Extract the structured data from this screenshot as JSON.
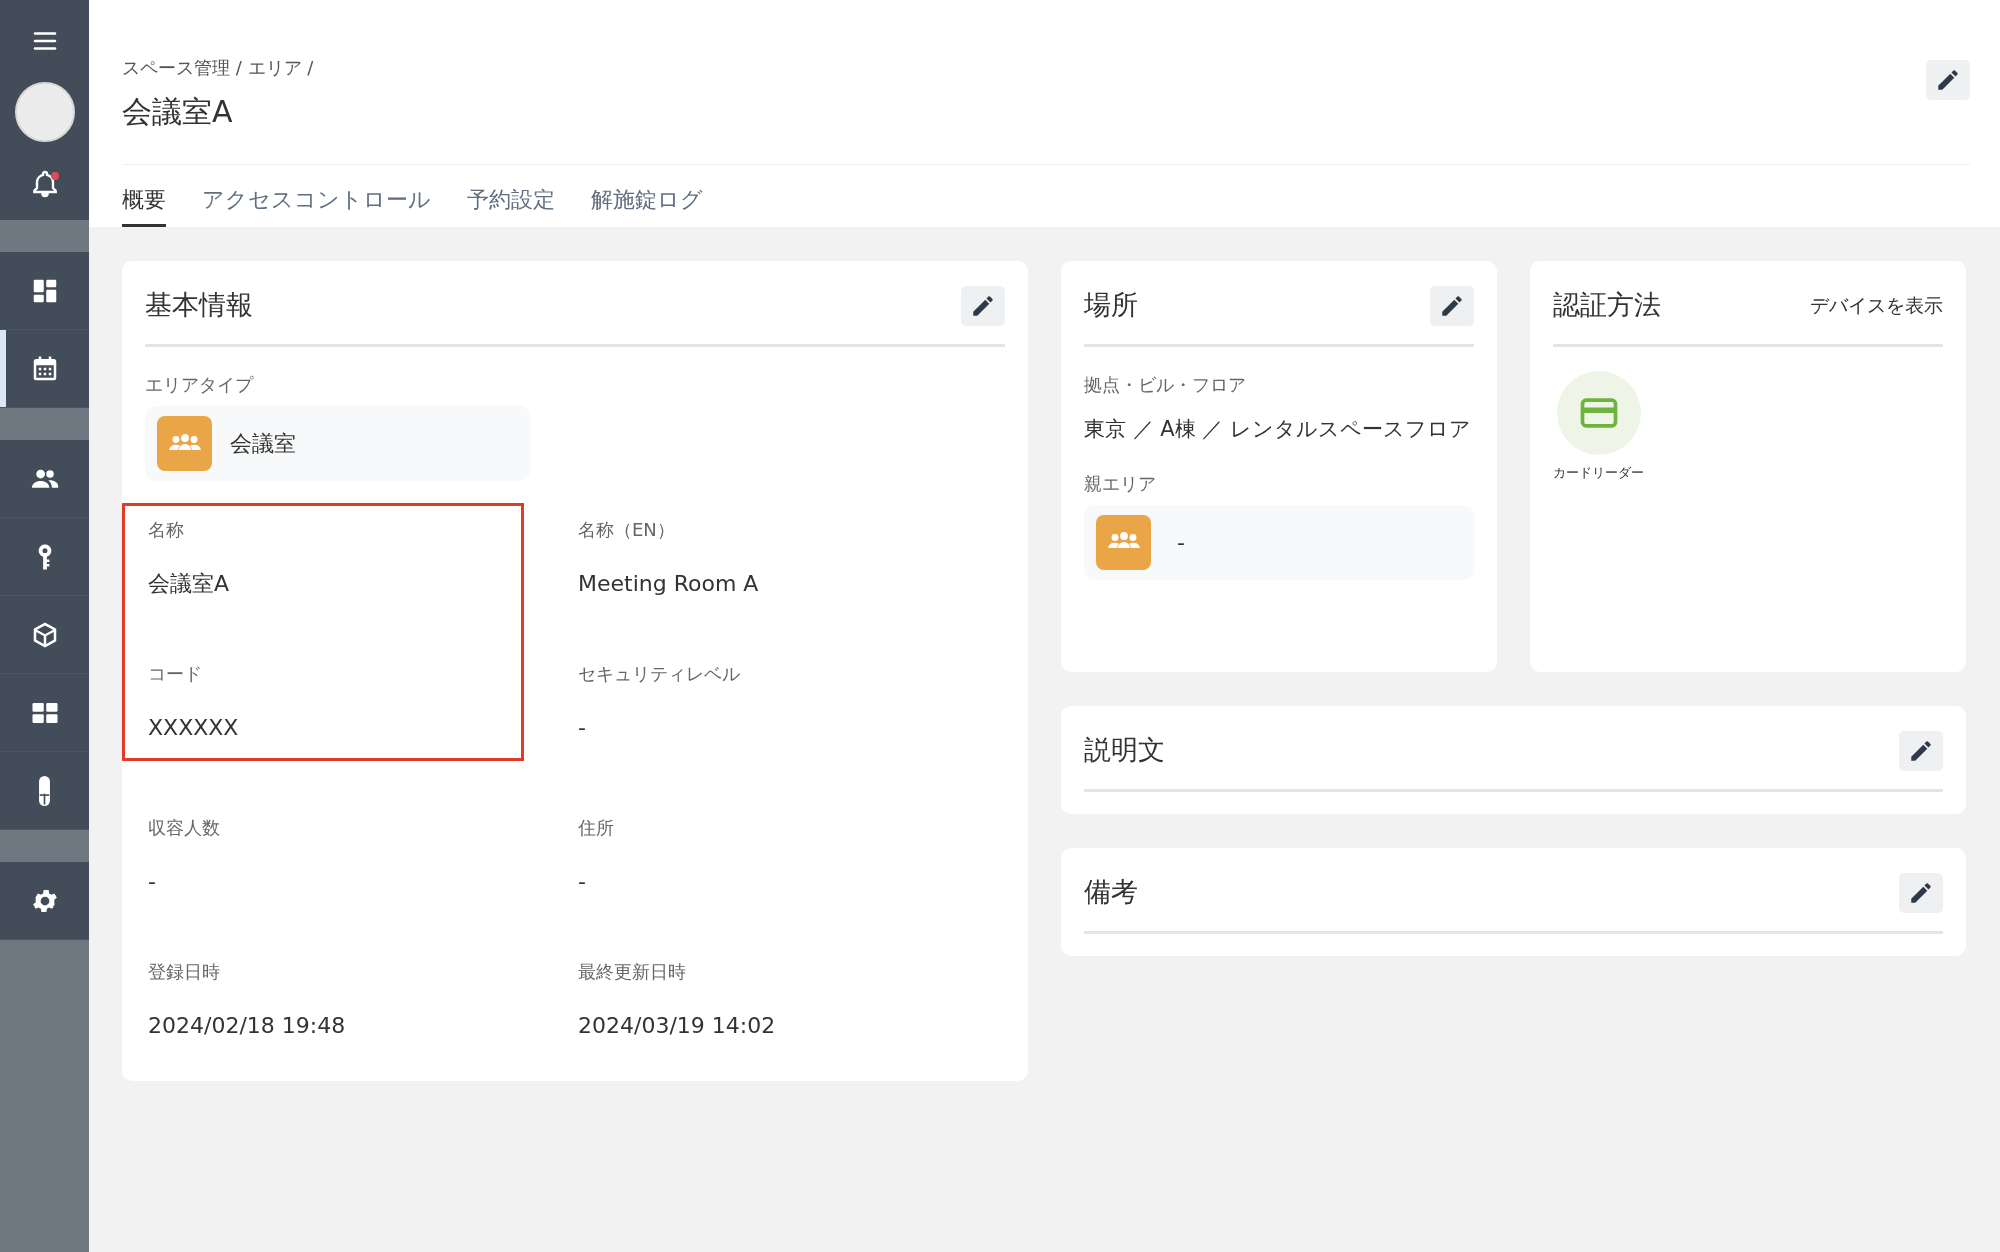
{
  "sidebar": {
    "notification": true,
    "sections": [
      {
        "items": [
          {
            "selected": false
          },
          {
            "selected": true
          }
        ]
      },
      {
        "items": [
          {
            "selected": false
          },
          {
            "selected": false
          },
          {
            "selected": false
          },
          {
            "selected": false
          },
          {
            "selected": false
          }
        ]
      },
      {
        "items": [
          {
            "selected": false
          }
        ]
      }
    ]
  },
  "header": {
    "breadcrumb": "スペース管理 / エリア /",
    "title": "会議室A"
  },
  "tabs": [
    {
      "label": "概要",
      "selected": true
    },
    {
      "label": "アクセスコントロール",
      "selected": false
    },
    {
      "label": "予約設定",
      "selected": false
    },
    {
      "label": "解施錠ログ",
      "selected": false
    }
  ],
  "basic_info": {
    "title": "基本情報",
    "area_type_label": "エリアタイプ",
    "area_type": "会議室",
    "sections": [
      {
        "highlighted": true,
        "fields": [
          {
            "label": "名称",
            "value": "会議室A"
          },
          {
            "label": "コード",
            "value": "XXXXXX"
          }
        ]
      },
      {
        "highlighted": false,
        "fields": [
          {
            "label": "名称（EN）",
            "value": "Meeting Room A"
          },
          {
            "label": "セキュリティレベル",
            "value": "-"
          }
        ]
      },
      {
        "highlighted": false,
        "fields": [
          {
            "label": "収容人数",
            "value": "-"
          },
          {
            "label": "登録日時",
            "value": "2024/02/18 19:48"
          }
        ]
      },
      {
        "highlighted": false,
        "fields": [
          {
            "label": "住所",
            "value": "-"
          },
          {
            "label": "最終更新日時",
            "value": "2024/03/19 14:02"
          }
        ]
      }
    ]
  },
  "location": {
    "title": "場所",
    "site_label": "拠点・ビル・フロア",
    "site": "東京 ／ A棟 ／ レンタルスペースフロア",
    "parent_label": "親エリア",
    "parent": "-"
  },
  "auth": {
    "title": "認証方法",
    "link": "デバイスを表示",
    "methods": [
      {
        "label": "カードリーダー"
      }
    ]
  },
  "description": {
    "title": "説明文"
  },
  "notes": {
    "title": "備考"
  }
}
